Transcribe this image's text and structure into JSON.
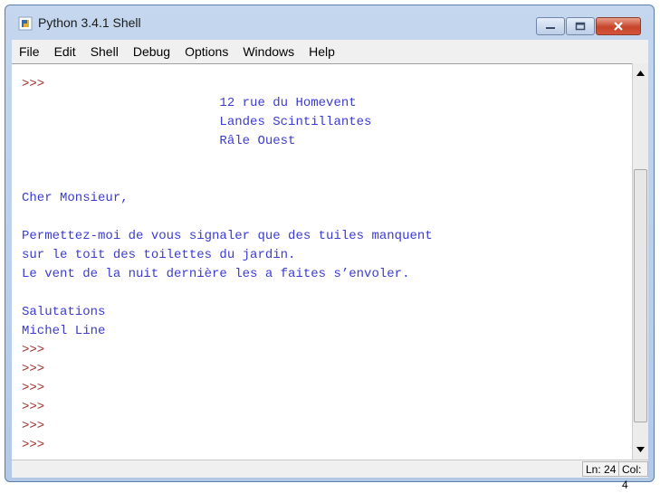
{
  "window": {
    "title": "Python 3.4.1 Shell"
  },
  "menu": [
    "File",
    "Edit",
    "Shell",
    "Debug",
    "Options",
    "Windows",
    "Help"
  ],
  "shell": {
    "lines": [
      {
        "text": ">>>",
        "kind": "prompt"
      },
      {
        "text": "                          12 rue du Homevent",
        "kind": "out"
      },
      {
        "text": "                          Landes Scintillantes",
        "kind": "out"
      },
      {
        "text": "                          Râle Ouest",
        "kind": "out"
      },
      {
        "text": "",
        "kind": "out"
      },
      {
        "text": "",
        "kind": "out"
      },
      {
        "text": "Cher Monsieur,",
        "kind": "out"
      },
      {
        "text": "",
        "kind": "out"
      },
      {
        "text": "Permettez-moi de vous signaler que des tuiles manquent",
        "kind": "out"
      },
      {
        "text": "sur le toit des toilettes du jardin.",
        "kind": "out"
      },
      {
        "text": "Le vent de la nuit dernière les a faites s’envoler.",
        "kind": "out"
      },
      {
        "text": "",
        "kind": "out"
      },
      {
        "text": "Salutations",
        "kind": "out"
      },
      {
        "text": "Michel Line",
        "kind": "out"
      },
      {
        "text": ">>>",
        "kind": "prompt"
      },
      {
        "text": ">>>",
        "kind": "prompt"
      },
      {
        "text": ">>>",
        "kind": "prompt"
      },
      {
        "text": ">>>",
        "kind": "prompt"
      },
      {
        "text": ">>>",
        "kind": "prompt"
      },
      {
        "text": ">>>",
        "kind": "prompt"
      }
    ]
  },
  "status": {
    "line": "Ln: 24",
    "col": "Col: 4"
  },
  "colors": {
    "prompt": "#a0322d",
    "output": "#3b3bd0"
  }
}
